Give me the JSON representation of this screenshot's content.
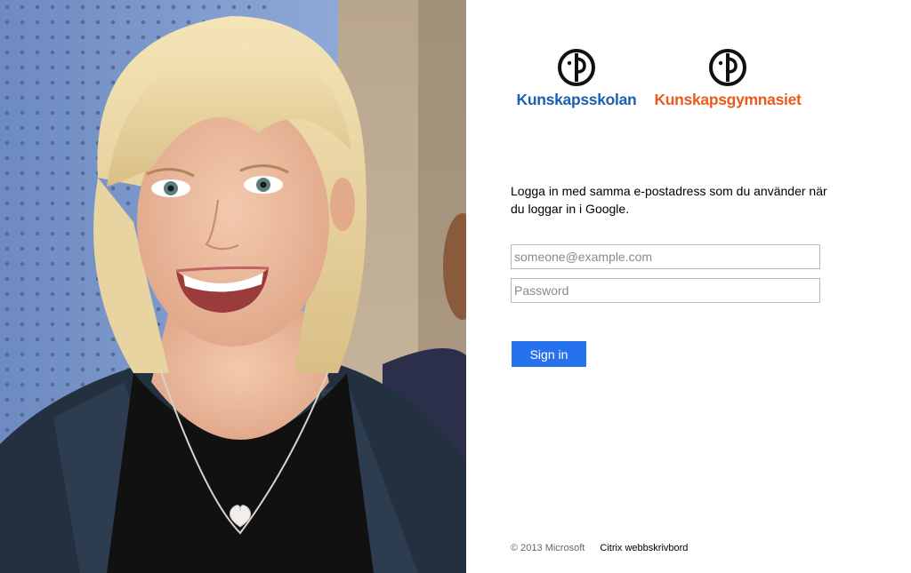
{
  "branding": {
    "logo_left_text": "Kunskapsskolan",
    "logo_right_text": "Kunskapsgymnasiet",
    "logo_left_color": "#1d5fb0",
    "logo_right_color": "#ea5a1c"
  },
  "login": {
    "intro_text": "Logga in med samma e-postadress som du använder när du loggar in i Google.",
    "email_placeholder": "someone@example.com",
    "email_value": "",
    "password_placeholder": "Password",
    "password_value": "",
    "submit_label": "Sign in",
    "submit_color": "#2672ec"
  },
  "footer": {
    "copyright": "© 2013 Microsoft",
    "link_label": "Citrix webbskrivbord"
  },
  "icons": {
    "logo_mark": "kunskapsskolan-emblem-icon"
  }
}
